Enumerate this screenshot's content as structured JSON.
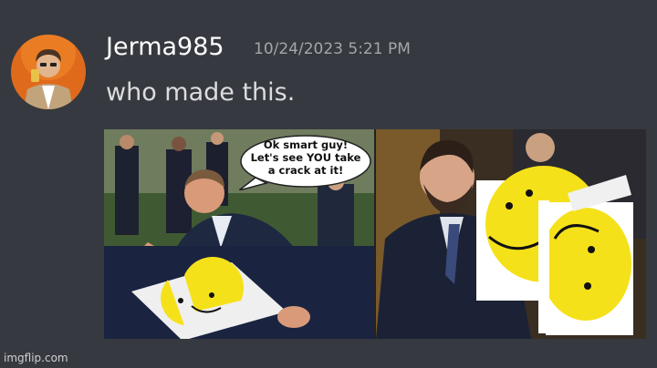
{
  "message": {
    "author": "Jerma985",
    "timestamp": "10/24/2023 5:21 PM",
    "text": "who made this."
  },
  "attachment": {
    "speech_bubble": [
      "Ok smart guy!",
      "Let's see YOU take",
      "a crack at it!"
    ]
  },
  "watermark": "imgflip.com",
  "colors": {
    "background": "#36393f",
    "author": "#ffffff",
    "timestamp": "#a3a6aa",
    "message": "#dcddde",
    "smiley": "#f5e11a"
  }
}
